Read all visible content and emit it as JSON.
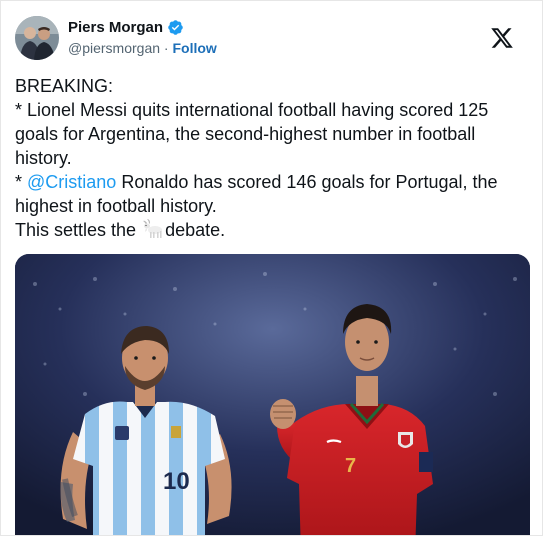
{
  "author": {
    "display_name": "Piers Morgan",
    "handle": "@piersmorgan",
    "separator": " · ",
    "follow_label": "Follow",
    "verified_icon": "verified-badge-icon",
    "avatar_icon": "profile-avatar"
  },
  "platform": {
    "logo_icon": "x-logo-icon"
  },
  "tweet": {
    "line1": "BREAKING:",
    "line2": "* Lionel Messi quits international football having scored 125 goals for Argentina, the second-highest number in football history.",
    "line3_prefix": "* ",
    "line3_mention": "@Cristiano",
    "line3_rest": " Ronaldo has scored 146 goals for Portugal, the highest in football history.",
    "line4_before": "This settles the ",
    "line4_emoji": "goat-emoji",
    "line4_after": "debate."
  },
  "media": {
    "jersey_left_number": "10",
    "jersey_right_number": "7"
  },
  "colors": {
    "link": "#1d9bf0",
    "follow": "#1d6fb8",
    "text": "#0f1419",
    "secondary": "#536471",
    "verified": "#1d9bf0"
  }
}
